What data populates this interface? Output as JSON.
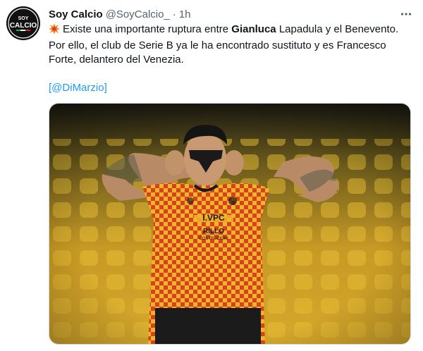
{
  "author": {
    "display_name": "Soy Calcio",
    "handle": "@SoyCalcio_",
    "separator": "·",
    "time": "1h",
    "avatar_text_top": "SOY",
    "avatar_text_main": "CALCIO"
  },
  "tweet": {
    "emoji": "collision-icon",
    "line1_pre": "Existe una importante ruptura entre ",
    "line1_bold": "Gianluca",
    "line1_post": " Lapadula y el Benevento.",
    "line2": "Por ello, el club de Serie B ya le ha encontrado sustituto y es Francesco Forte, delantero del Venezia.",
    "credit_open": "[",
    "credit_mention": "@DiMarzio",
    "credit_close": "]"
  },
  "photo": {
    "jersey_sponsor": "I.VPC",
    "jersey_sponsor2": "RILLO",
    "jersey_sponsor2_sub": "COSTRUZIONI",
    "colors": {
      "seats": "#e1b52b",
      "jersey_red": "#d8411e",
      "jersey_yellow": "#f2b42a"
    }
  },
  "colors": {
    "link": "#1d9bf0",
    "secondary": "#536471",
    "primary": "#0f1419"
  }
}
